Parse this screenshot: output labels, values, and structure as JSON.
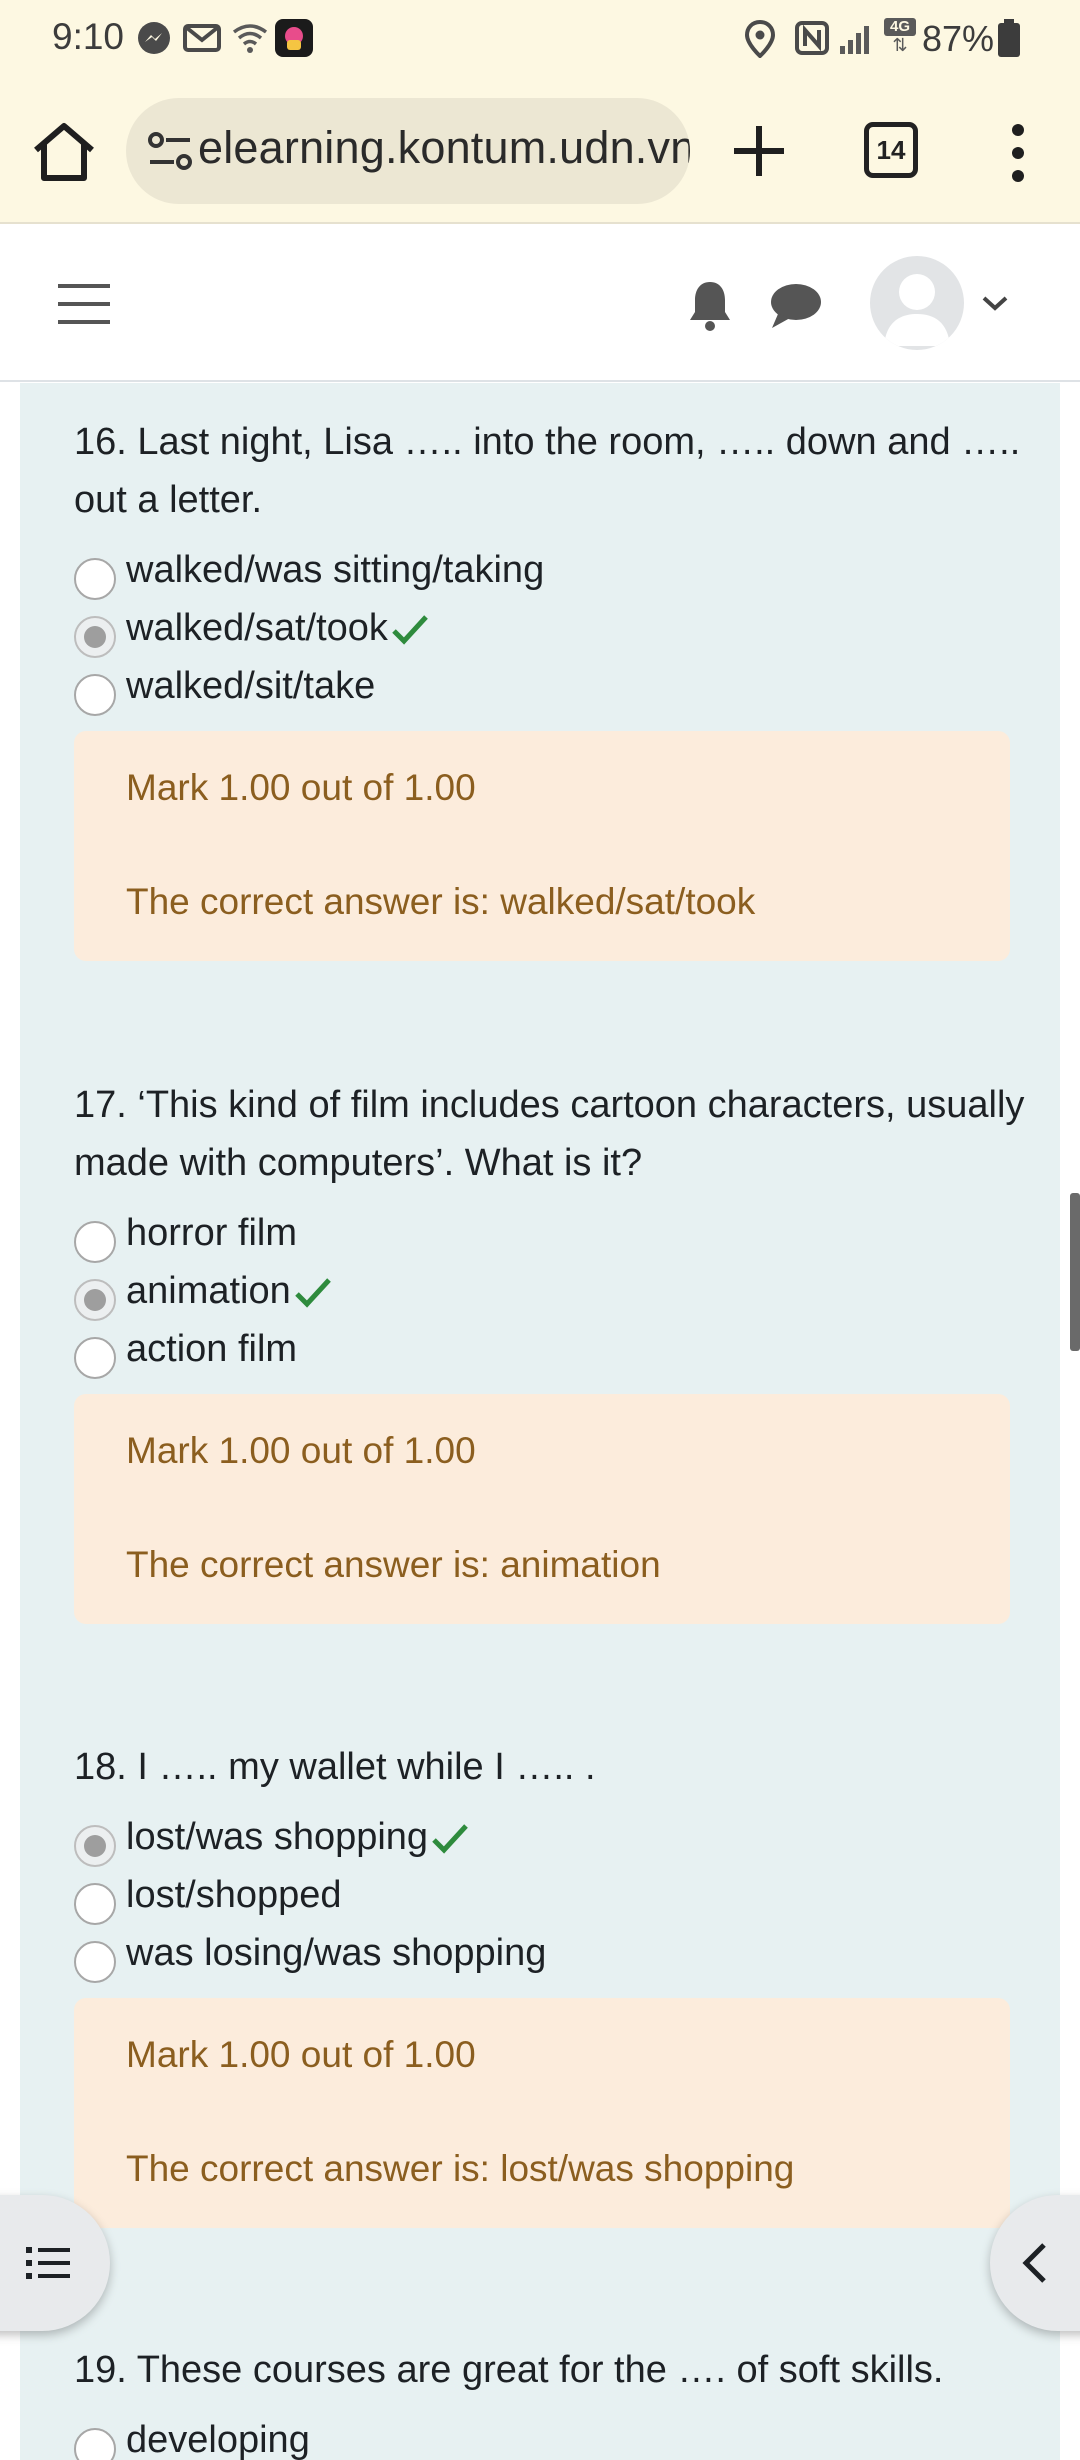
{
  "status_bar": {
    "time": "9:10",
    "battery": "87%",
    "network": "4G",
    "icons": [
      "messenger-icon",
      "missed-call-icon",
      "wifi-icon",
      "app-icon",
      "location-icon",
      "nfc-icon",
      "signal-icon",
      "battery-icon"
    ]
  },
  "browser": {
    "url": "elearning.kontum.udn.vn",
    "tab_count": "14",
    "icons": [
      "home-icon",
      "site-info-icon",
      "plus-icon",
      "more-vert-icon"
    ]
  },
  "navbar": {
    "icons": [
      "hamburger-icon",
      "bell-icon",
      "chat-icon",
      "avatar-icon",
      "chevron-down-icon"
    ]
  },
  "questions": [
    {
      "text": "16. Last night, Lisa ….. into the room, ….. down and ….. out a letter.",
      "options": [
        {
          "label": "walked/was sitting/taking",
          "selected": false,
          "correct": false
        },
        {
          "label": "walked/sat/took",
          "selected": true,
          "correct": true
        },
        {
          "label": "walked/sit/take",
          "selected": false,
          "correct": false
        }
      ],
      "mark": "Mark 1.00 out of 1.00",
      "correct_answer": "The correct answer is: walked/sat/took"
    },
    {
      "text": "17. ‘This kind of film includes cartoon characters, usually made with computers’. What is it?",
      "options": [
        {
          "label": "horror film",
          "selected": false,
          "correct": false
        },
        {
          "label": "animation",
          "selected": true,
          "correct": true
        },
        {
          "label": "action film",
          "selected": false,
          "correct": false
        }
      ],
      "mark": "Mark 1.00 out of 1.00",
      "correct_answer": "The correct answer is: animation"
    },
    {
      "text": "18. I ….. my wallet while I ….. .",
      "options": [
        {
          "label": "lost/was shopping",
          "selected": true,
          "correct": true
        },
        {
          "label": "lost/shopped",
          "selected": false,
          "correct": false
        },
        {
          "label": "was losing/was shopping",
          "selected": false,
          "correct": false
        }
      ],
      "mark": "Mark 1.00 out of 1.00",
      "correct_answer": "The correct answer is: lost/was shopping"
    },
    {
      "text": "19. These courses are great for the …. of soft skills.",
      "options": [
        {
          "label": "developing",
          "selected": false,
          "correct": false
        }
      ]
    }
  ],
  "colors": {
    "browser_bg": "#fdf8e2",
    "content_bg": "#e7f1f2",
    "feedback_bg": "#fcecdc",
    "feedback_text": "#8b5e1f",
    "correct_tick": "#2e8b3d"
  },
  "floating": {
    "left_icon": "list-icon",
    "right_icon": "chevron-left-icon"
  }
}
